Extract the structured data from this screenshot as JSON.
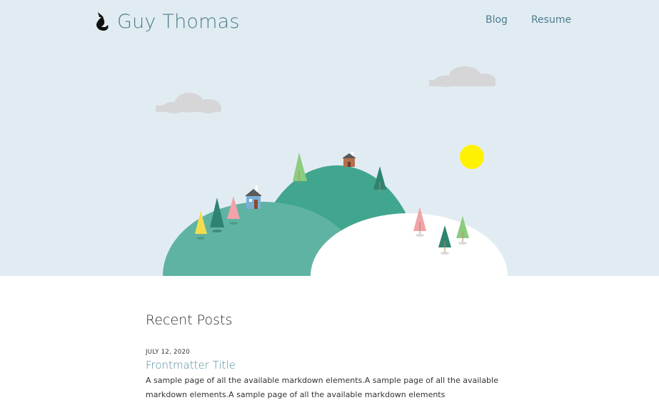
{
  "header": {
    "logo_icon": "fox-head-icon",
    "site_title": "Guy Thomas",
    "nav": [
      {
        "label": "Blog"
      },
      {
        "label": "Resume"
      }
    ]
  },
  "hero": {
    "sky_color": "#e1ecf2",
    "sun_color": "#fff200",
    "hill_color": "#5fb3a2",
    "hill_dark_color": "#3fa48c",
    "snow_color": "#ffffff",
    "cloud_color": "#d6d6d8"
  },
  "recent_posts": {
    "heading": "Recent Posts",
    "posts": [
      {
        "date": "July 12, 2020",
        "title": "Frontmatter Title",
        "excerpt": "A sample page of all the available markdown elements.A sample page of all the available markdown elements.A sample page of all the available markdown elements"
      }
    ]
  }
}
